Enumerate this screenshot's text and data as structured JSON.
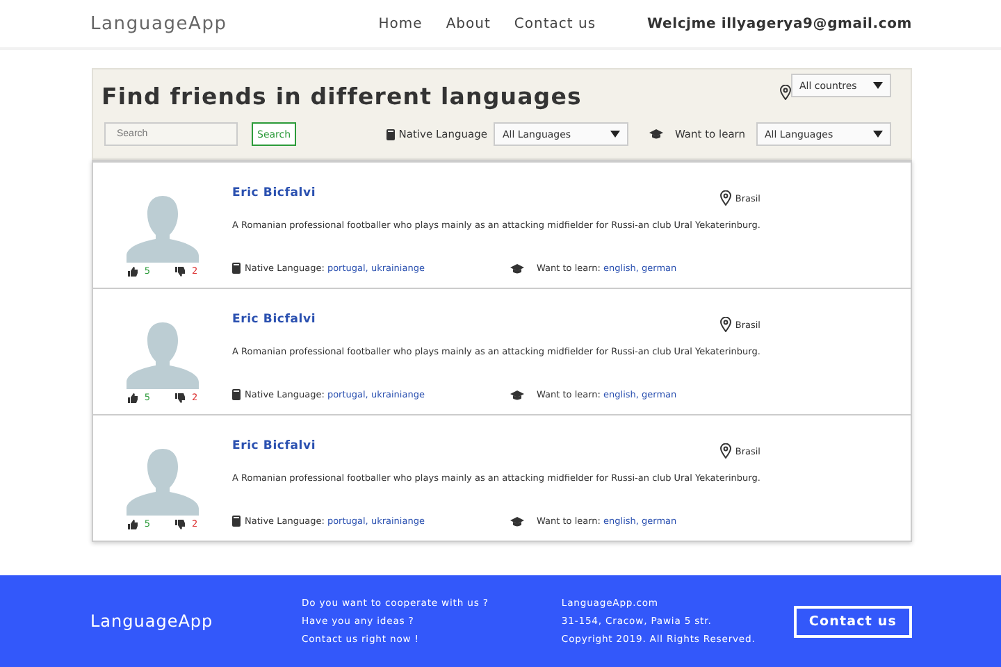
{
  "header": {
    "logo": "LanguageApp",
    "nav": [
      "Home",
      "About",
      "Contact us"
    ],
    "welcome": "Welcjme illyagerya9@gmail.com"
  },
  "filters": {
    "title": "Find friends in different languages",
    "country": "All countres",
    "search_placeholder": "Search",
    "search_button": "Search",
    "native_label": "Native Language",
    "native_value": "All Languages",
    "learn_label": "Want to learn",
    "learn_value": "All Languages"
  },
  "users": [
    {
      "name": "Eric Bicfalvi",
      "location": "Brasil",
      "description": "A Romanian professional footballer who plays mainly as an attacking midfielder for Russi-an club Ural Yekaterinburg.",
      "likes": "5",
      "dislikes": "2",
      "native_label": "Native Language:",
      "native": "portugal, ukrainiange",
      "learn_label": "Want to learn:",
      "learn": "english, german"
    },
    {
      "name": "Eric Bicfalvi",
      "location": "Brasil",
      "description": "A Romanian professional footballer who plays mainly as an attacking midfielder for Russi-an club Ural Yekaterinburg.",
      "likes": "5",
      "dislikes": "2",
      "native_label": "Native Language:",
      "native": "portugal, ukrainiange",
      "learn_label": "Want to learn:",
      "learn": "english, german"
    },
    {
      "name": "Eric Bicfalvi",
      "location": "Brasil",
      "description": "A Romanian professional footballer who plays mainly as an attacking midfielder for Russi-an club Ural Yekaterinburg.",
      "likes": "5",
      "dislikes": "2",
      "native_label": "Native Language:",
      "native": "portugal, ukrainiange",
      "learn_label": "Want to learn:",
      "learn": "english, german"
    }
  ],
  "footer": {
    "logo": "LanguageApp",
    "lines": [
      "Do you want to cooperate with us ?",
      "Have you any ideas ?",
      "Contact us right now !"
    ],
    "info": [
      "LanguageApp.com",
      "31-154, Cracow, Pawia 5 str.",
      "Copyright 2019. All Rights Reserved."
    ],
    "button": "Contact us"
  }
}
